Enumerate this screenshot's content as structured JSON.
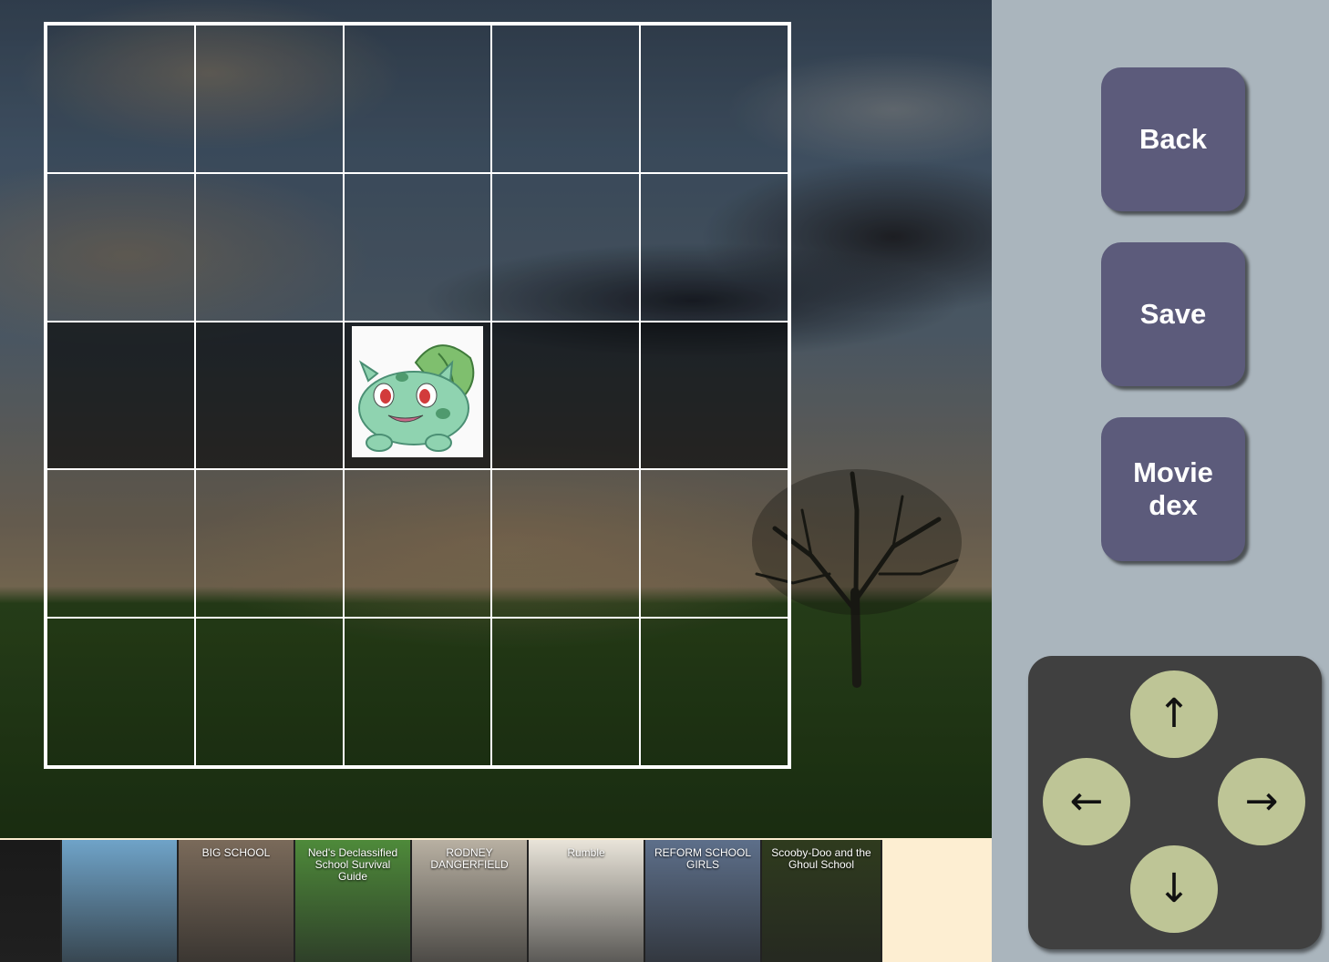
{
  "menu": {
    "back_label": "Back",
    "save_label": "Save",
    "moviedex_line1": "Movie",
    "moviedex_line2": "dex"
  },
  "dpad": {
    "up": "↑",
    "left": "←",
    "right": "→",
    "down": "↓"
  },
  "board": {
    "rows": 5,
    "cols": 5,
    "player": {
      "row": 3,
      "col": 3,
      "icon": "bulbasaur-sprite"
    }
  },
  "posters": [
    {
      "title": "",
      "color": "#1a1a1a"
    },
    {
      "title": "",
      "color": "#6fa3c8"
    },
    {
      "title": "BIG SCHOOL",
      "color": "#7a6a5a"
    },
    {
      "title": "Ned's Declassified School Survival Guide",
      "color": "#4e8a3a"
    },
    {
      "title": "RODNEY DANGERFIELD",
      "color": "#b8b0a2"
    },
    {
      "title": "Rumble",
      "color": "#e9e4d9"
    },
    {
      "title": "REFORM SCHOOL GIRLS",
      "color": "#5d6f8a"
    },
    {
      "title": "Scooby-Doo and the Ghoul School",
      "color": "#2f3b1e"
    }
  ]
}
